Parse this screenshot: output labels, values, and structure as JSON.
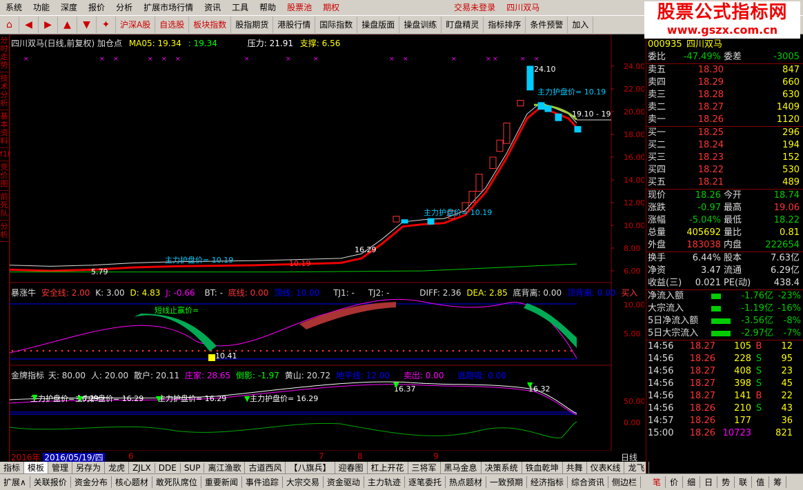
{
  "menu": [
    "系统",
    "功能",
    "深度",
    "报价",
    "分析",
    "扩展市场行情",
    "资讯",
    "工具",
    "帮助"
  ],
  "menu_red": "股票池",
  "menu_extra": "期权",
  "login": "交易未登录",
  "stock_name_top": "四川双马",
  "toolbar": [
    "沪深A股",
    "自选股",
    "板块指数",
    "股指期货",
    "港股行情",
    "国际指数",
    "操盘版面",
    "操盘训练",
    "盯盘精灵",
    "指标排序",
    "条件预警",
    "加入"
  ],
  "logo": {
    "line1": "股票公式指标网",
    "line2": "www.gszx.com.cn"
  },
  "leftbar": [
    "分时走势",
    "技术分析",
    "基本资料",
    "f10",
    "竞价图",
    "前死队",
    "分析"
  ],
  "main_info": {
    "title": "四川双马(日线,前复权) 加仓点",
    "ma": "MA05: 19.34",
    "ma2": ": 19.34",
    "pressure": "压力: 21.91",
    "support": "支撑: 6.56"
  },
  "price_axis": [
    "24.00",
    "22.00",
    "20.00",
    "18.00",
    "16.00",
    "14.00",
    "12.00",
    "10.00",
    "8.00",
    "6.00"
  ],
  "annotations": {
    "high": "24.10",
    "zhuli1": "主力护盘价= 10.19",
    "zhuli2": "主力护盘价= 10.19",
    "zhuli3": "主力护盘价= 10.19",
    "price1": "16.29",
    "price2": "19.10 - 19",
    "low": "5.79",
    "p1019": "10.19"
  },
  "sub1_info": {
    "name": "暴涨牛",
    "safe": "安全线: 2.00",
    "k": "K: 3.00",
    "d": "D: 4.83",
    "j": "J: -0.66",
    "bt": "BT: -",
    "bottom": "底线: 0.00",
    "top": "顶线: 10.00",
    "tj1": "TJ1: -",
    "tj2": "TJ2: -",
    "diff": "DIFF: 2.36",
    "dea": "DEA: 2.85",
    "bottom_gap": "底背离: 0.00",
    "top_gap": "顶背离: 0.00",
    "buy": "买入"
  },
  "sub1_axis": [
    "10.00",
    "5.00"
  ],
  "sub1_note": "短线止赢价=",
  "sub1_val": "10.41",
  "sub2_info": {
    "name": "金牌指标",
    "tian": "天: 80.00",
    "ren": "人: 20.00",
    "sanhu": "散户: 20.11",
    "zhuangjia": "庄家: 28.65",
    "daoying": "倒影: -1.97",
    "huangshan": "黄山: 20.72",
    "dipingxian": "地平线: 12.00",
    "sell": "卖出: 0.00",
    "escape": "逃跑吸: 0.00"
  },
  "sub2_axis": [
    "50.00",
    "0.00"
  ],
  "sub2_notes": [
    "主力护盘价= 16.29",
    "主力护盘价= 16.29",
    "主力护盘价= 16.29",
    "主力护盘价= 16.29",
    "16.37",
    "16.32"
  ],
  "date_axis": {
    "year": "2016年",
    "date": "2016/05/19/四",
    "d6": "6",
    "d7": "7",
    "d8": "8",
    "d9": "9",
    "period": "日线"
  },
  "quote": {
    "code": "000935",
    "name": "四川双马",
    "weibi": "委比",
    "weibi_v": "-47.49%",
    "weicha": "委差",
    "weicha_v": "-3005"
  },
  "sells": [
    [
      "卖五",
      "18.30",
      "847"
    ],
    [
      "卖四",
      "18.29",
      "660"
    ],
    [
      "卖三",
      "18.28",
      "630"
    ],
    [
      "卖二",
      "18.27",
      "1409"
    ],
    [
      "卖一",
      "18.26",
      "1120"
    ]
  ],
  "buys": [
    [
      "买一",
      "18.25",
      "296"
    ],
    [
      "买二",
      "18.24",
      "194"
    ],
    [
      "买三",
      "18.23",
      "152"
    ],
    [
      "买四",
      "18.22",
      "530"
    ],
    [
      "买五",
      "18.21",
      "489"
    ]
  ],
  "stats": [
    [
      "现价",
      "18.26",
      "今开",
      "18.74"
    ],
    [
      "涨跌",
      "-0.97",
      "最高",
      "19.06"
    ],
    [
      "涨幅",
      "-5.04%",
      "最低",
      "18.22"
    ],
    [
      "总量",
      "405692",
      "量比",
      "0.81"
    ],
    [
      "外盘",
      "183038",
      "内盘",
      "222654"
    ]
  ],
  "stats2": [
    [
      "换手",
      "6.44%",
      "股本",
      "7.63亿"
    ],
    [
      "净资",
      "3.47",
      "流通",
      "6.29亿"
    ],
    [
      "收益(三)",
      "0.021",
      "PE(动)",
      "438.4"
    ]
  ],
  "flows": [
    [
      "净流入额",
      "-1.76亿",
      "-23%"
    ],
    [
      "大宗流入",
      "-1.19亿",
      "-16%"
    ],
    [
      "5日净流入额",
      "-3.56亿",
      "-8%"
    ],
    [
      "5日大宗流入",
      "-2.97亿",
      "-7%"
    ]
  ],
  "ticks": [
    [
      "14:56",
      "18.27",
      "105",
      "B",
      "12"
    ],
    [
      "14:56",
      "18.26",
      "228",
      "S",
      "95"
    ],
    [
      "14:56",
      "18.27",
      "408",
      "S",
      "23"
    ],
    [
      "14:56",
      "18.27",
      "398",
      "S",
      "45"
    ],
    [
      "14:56",
      "18.27",
      "141",
      "B",
      "22"
    ],
    [
      "14:56",
      "18.26",
      "210",
      "S",
      "43"
    ],
    [
      "14:57",
      "18.26",
      "177",
      "",
      "36"
    ],
    [
      "15:00",
      "18.26",
      "10723",
      "",
      "821"
    ]
  ],
  "bottom1": [
    "指标",
    "模板",
    "管理",
    "另存为",
    "龙虎",
    "ZJLX",
    "DDE",
    "SUP",
    "离江渔歌",
    "古道西风",
    "【八旗兵】",
    "迎春图",
    "杠上开花",
    "三将军",
    "黑马金息",
    "决策系统",
    "铁血乾坤",
    "共舞",
    "仪表K线",
    "龙飞"
  ],
  "bottom2": [
    "扩展∧",
    "关联报价",
    "资金分布",
    "核心题材",
    "敢死队席位",
    "重要新闻",
    "事件追踪",
    "大宗交易",
    "资金驱动",
    "主力轨迹",
    "逐笔委托",
    "热点题材",
    "一致预期",
    "经济指标",
    "综合资讯",
    "侧边栏"
  ],
  "bottom2_right": [
    "笔",
    "价",
    "细",
    "日",
    "势",
    "联",
    "值",
    "筹"
  ]
}
